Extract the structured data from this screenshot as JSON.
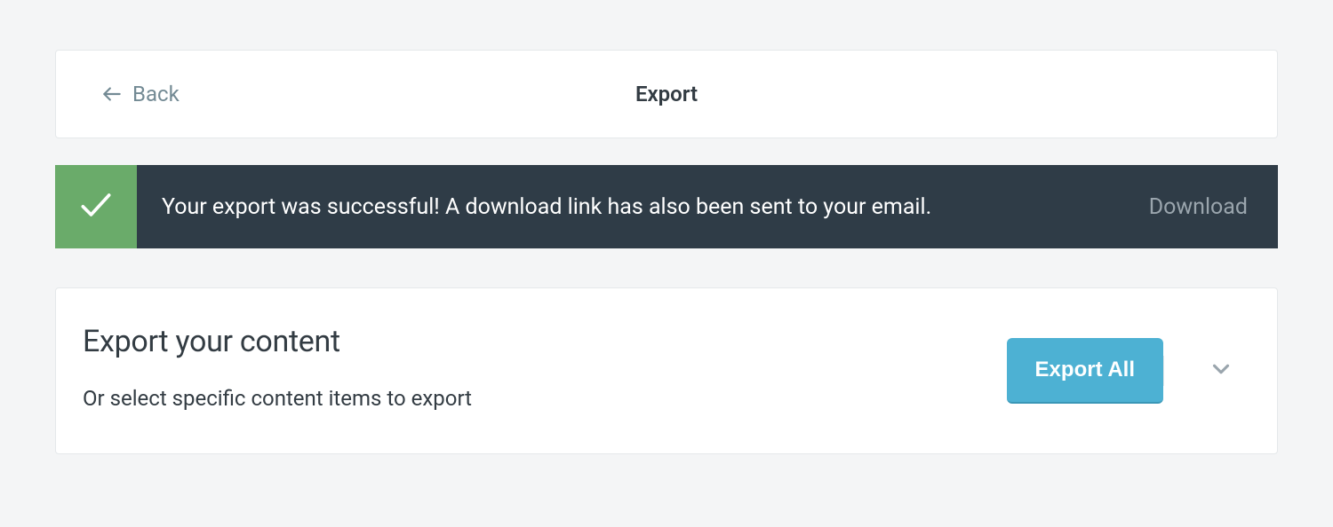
{
  "header": {
    "back_label": "Back",
    "title": "Export"
  },
  "notification": {
    "message": "Your export was successful! A download link has also been sent to your email.",
    "action_label": "Download"
  },
  "export_panel": {
    "title": "Export your content",
    "subtitle": "Or select specific content items to export",
    "export_all_label": "Export All"
  },
  "colors": {
    "page_bg": "#f4f5f6",
    "card_bg": "#ffffff",
    "card_border": "#e5e8ea",
    "muted_text": "#738a94",
    "dark_text": "#333c43",
    "notification_bg": "#2f3c47",
    "success_green": "#6aab6a",
    "notification_text": "#ffffff",
    "notification_action": "#9aa5ad",
    "primary_button": "#4db1d3",
    "primary_button_shadow": "#3a97b7"
  }
}
